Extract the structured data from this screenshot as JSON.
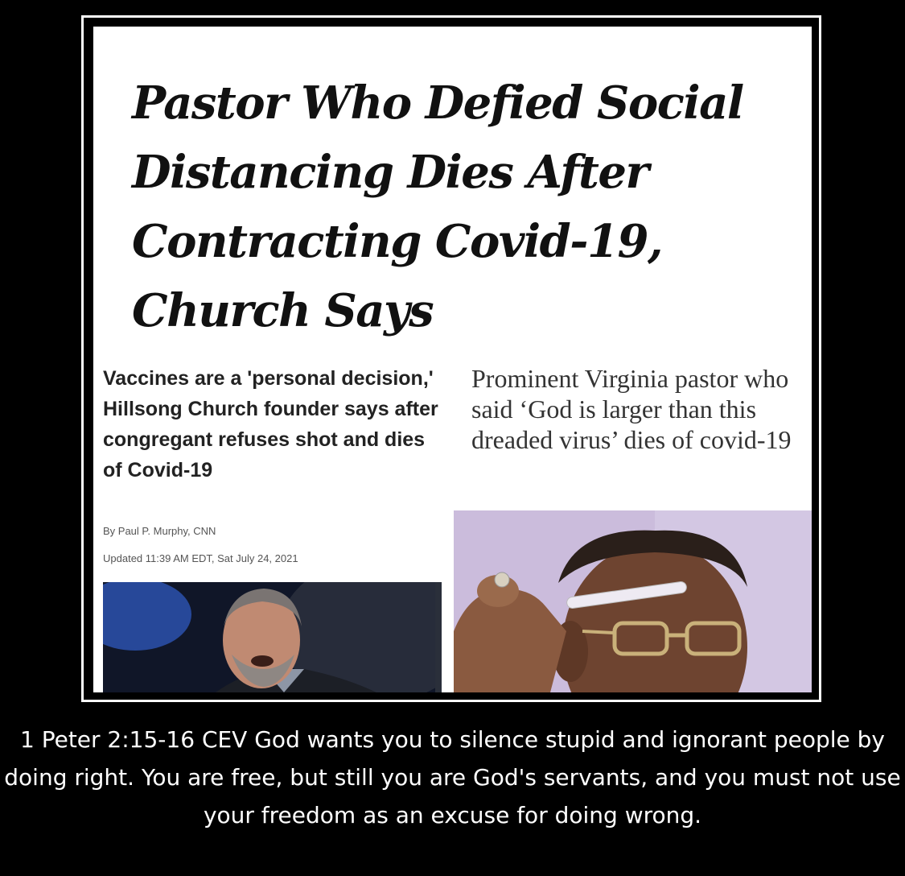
{
  "headline": "Pastor Who Defied Social Distancing Dies After Contracting Covid-19, Church Says",
  "cnn_article": {
    "title": "Vaccines are a 'personal decision,' Hillsong Church founder says after congregant refuses shot and dies of Covid-19",
    "byline": "By Paul P. Murphy, CNN",
    "updated": "Updated 11:39 AM EDT, Sat July 24, 2021"
  },
  "wapo_article": {
    "title": "Prominent Virginia pastor who said ‘God is larger than this dreaded virus’ dies of covid-19"
  },
  "caption": "1 Peter 2:15-16 CEV  God wants you to silence stupid and ignorant people by doing right. You are free, but still you are God's servants, and you must not use your freedom as an excuse for doing wrong."
}
